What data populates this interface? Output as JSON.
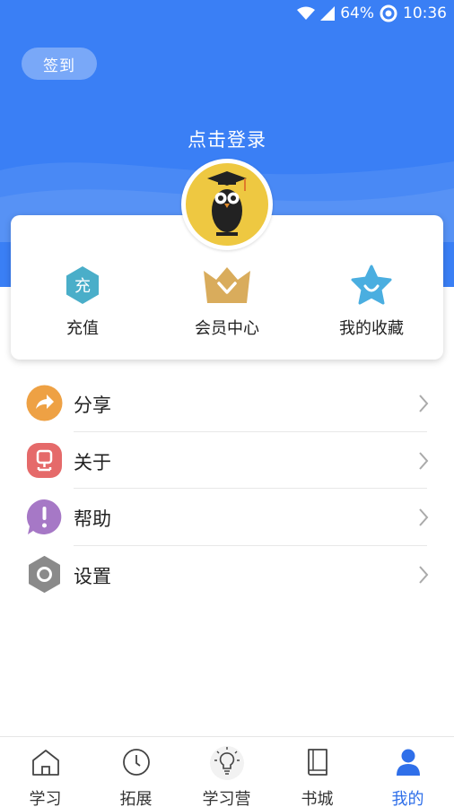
{
  "status_bar": {
    "battery": "64%",
    "time": "10:36"
  },
  "header": {
    "signin_label": "签到",
    "login_prompt": "点击登录"
  },
  "quick_actions": [
    {
      "label": "充值",
      "icon": "recharge-hexagon-icon",
      "badge": "充",
      "color": "#4aaec9"
    },
    {
      "label": "会员中心",
      "icon": "crown-icon",
      "color": "#d9ac5c"
    },
    {
      "label": "我的收藏",
      "icon": "star-icon",
      "color": "#4aaee0"
    }
  ],
  "menu": [
    {
      "label": "分享",
      "icon": "share-icon",
      "color": "#eea144"
    },
    {
      "label": "关于",
      "icon": "about-icon",
      "color": "#e56a6a"
    },
    {
      "label": "帮助",
      "icon": "help-icon",
      "color": "#a678c6"
    },
    {
      "label": "设置",
      "icon": "settings-icon",
      "color": "#8a8a8a"
    }
  ],
  "tabs": [
    {
      "label": "学习",
      "icon": "home-icon",
      "active": false
    },
    {
      "label": "拓展",
      "icon": "clock-icon",
      "active": false
    },
    {
      "label": "学习营",
      "icon": "bulb-icon",
      "active": false
    },
    {
      "label": "书城",
      "icon": "book-icon",
      "active": false
    },
    {
      "label": "我的",
      "icon": "user-icon",
      "active": true
    }
  ],
  "colors": {
    "brand_blue": "#3a7ff5",
    "active_tab": "#2f6fe9"
  }
}
